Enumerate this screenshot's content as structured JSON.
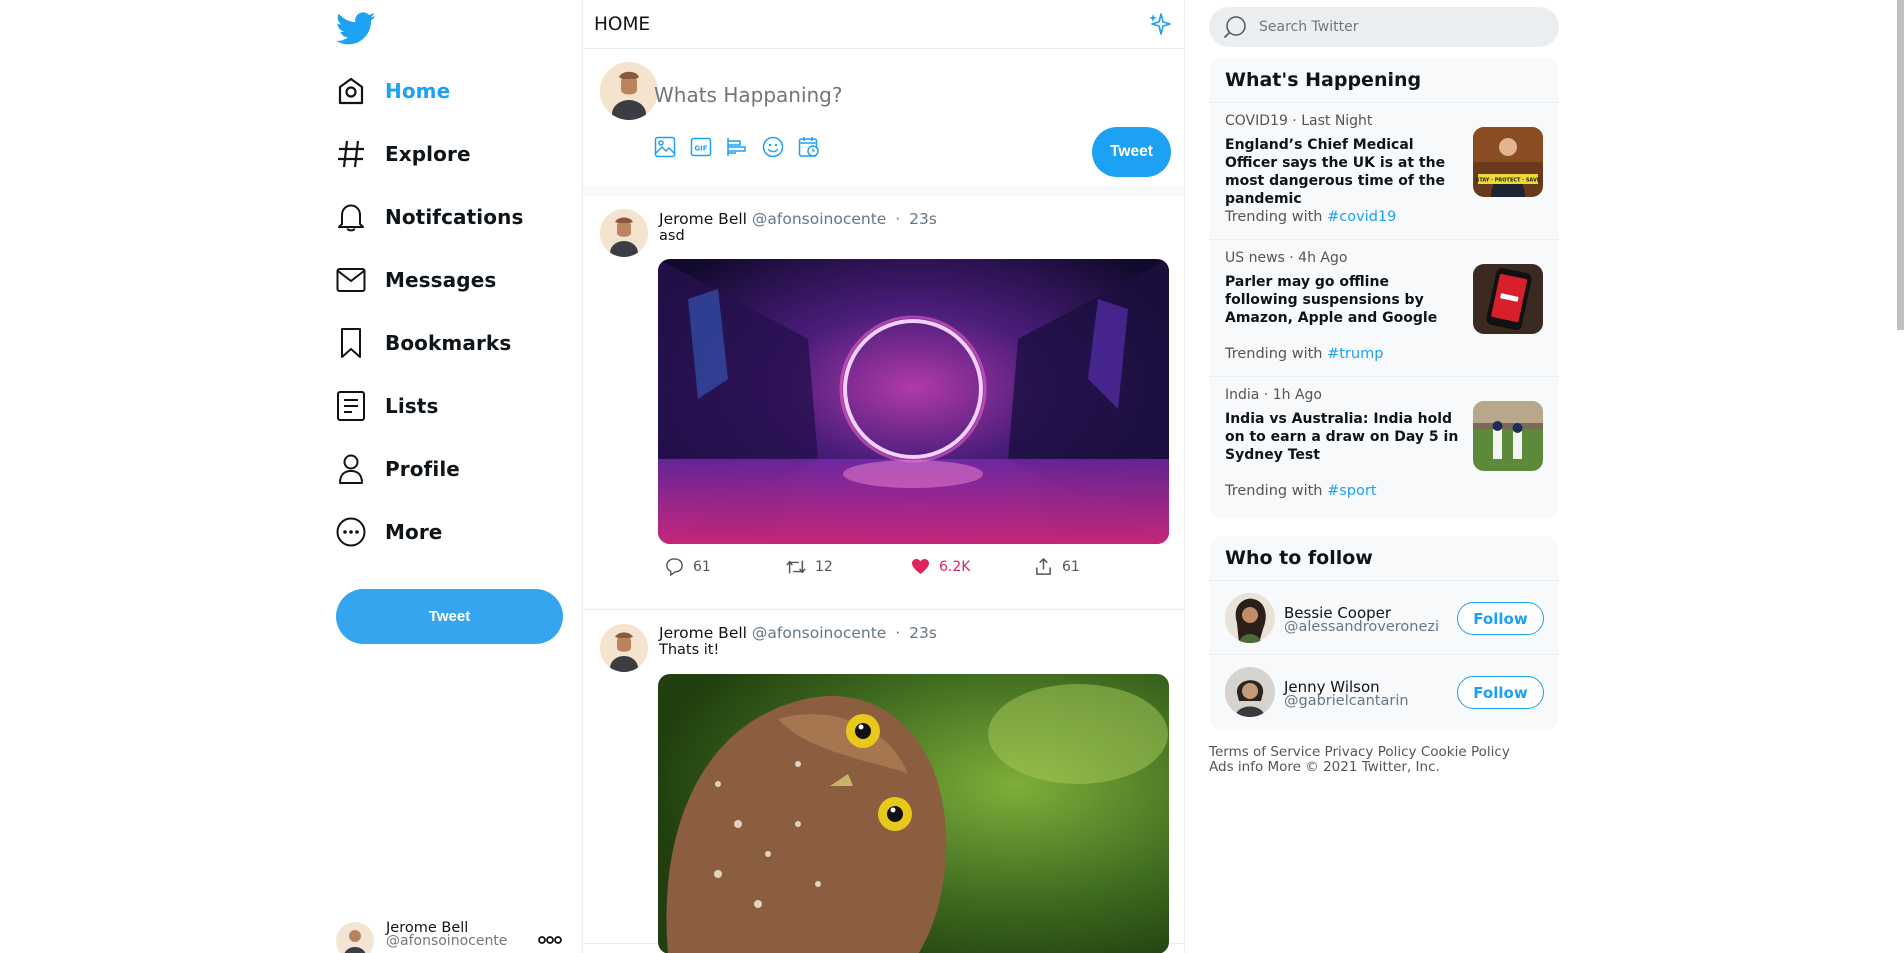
{
  "sidebar": {
    "items": [
      {
        "label": "Home",
        "icon": "home-icon",
        "active": true
      },
      {
        "label": "Explore",
        "icon": "hashtag-icon"
      },
      {
        "label": "Notifcations",
        "icon": "bell-icon"
      },
      {
        "label": "Messages",
        "icon": "mail-icon"
      },
      {
        "label": "Bookmarks",
        "icon": "bookmark-icon"
      },
      {
        "label": "Lists",
        "icon": "list-icon"
      },
      {
        "label": "Profile",
        "icon": "user-icon"
      },
      {
        "label": "More",
        "icon": "more-circle-icon"
      }
    ],
    "tweet_label": "Tweet",
    "profile": {
      "name": "Jerome Bell",
      "handle": "@afonsoinocente"
    }
  },
  "header": {
    "title": "HOME"
  },
  "compose": {
    "placeholder": "Whats Happaning?",
    "tweet_label": "Tweet"
  },
  "tweets": [
    {
      "name": "Jerome Bell",
      "handle": "@afonsoinocente",
      "sep": "·",
      "time": "23s",
      "text": "asd",
      "replies": "61",
      "retweets": "12",
      "likes": "6.2K",
      "shares": "61"
    },
    {
      "name": "Jerome Bell",
      "handle": "@afonsoinocente",
      "sep": "·",
      "time": "23s",
      "text": "Thats it!"
    }
  ],
  "search": {
    "placeholder": "Search Twitter"
  },
  "whats_happening": {
    "title": "What's Happening",
    "trends": [
      {
        "meta": "COVID19 · Last Night",
        "headline": "England’s Chief Medical Officer says the UK is at the most dangerous time of the pandemic",
        "with_label": "Trending with",
        "tag": "#covid19"
      },
      {
        "meta": "US news · 4h Ago",
        "headline": "Parler may go offline following suspensions by Amazon, Apple and Google",
        "with_label": "Trending with",
        "tag": "#trump"
      },
      {
        "meta": "India · 1h Ago",
        "headline": "India vs Australia: India hold on to earn a draw on Day 5 in Sydney Test",
        "with_label": "Trending with",
        "tag": "#sport"
      }
    ]
  },
  "who_to_follow": {
    "title": "Who to follow",
    "users": [
      {
        "name": "Bessie Cooper",
        "handle": "@alessandroveronezi",
        "button": "Follow"
      },
      {
        "name": "Jenny Wilson",
        "handle": "@gabrielcantarin",
        "button": "Follow"
      }
    ]
  },
  "footer": {
    "links": [
      "Terms of Service",
      "Privacy Policy",
      "Cookie Policy",
      "Ads info",
      "More"
    ],
    "copyright": "© 2021 Twitter, Inc."
  },
  "colors": {
    "brand": "#1da1f2",
    "like": "#e0245e"
  }
}
